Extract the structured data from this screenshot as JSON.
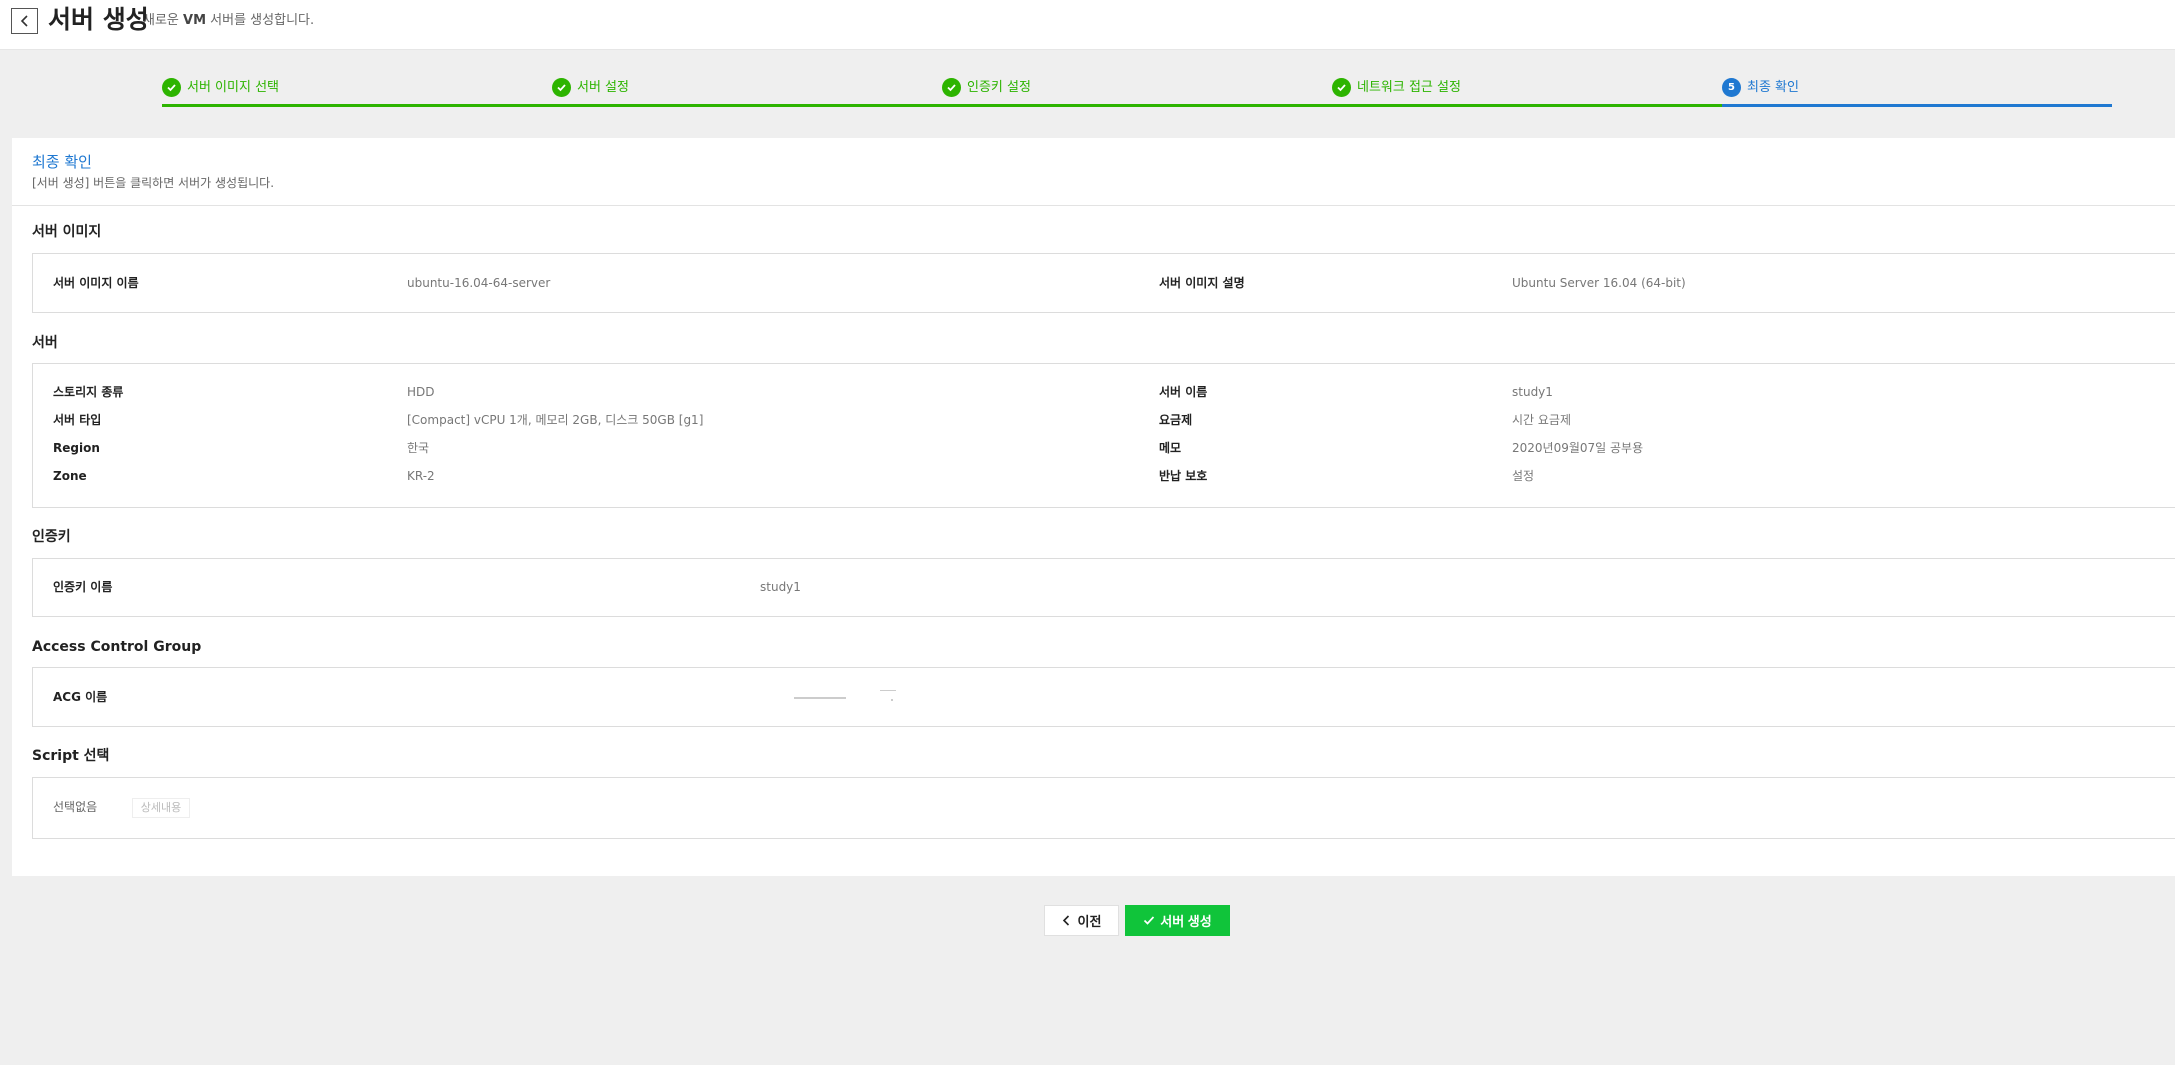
{
  "header": {
    "title": "서버 생성",
    "subtitle_prefix": "새로운",
    "subtitle_vm": "VM",
    "subtitle_suffix": "서버를 생성합니다."
  },
  "steps": [
    {
      "label": "서버 이미지 선택",
      "status": "done"
    },
    {
      "label": "서버 설정",
      "status": "done"
    },
    {
      "label": "인증키 설정",
      "status": "done"
    },
    {
      "label": "네트워크 접근 설정",
      "status": "done"
    },
    {
      "label": "최종 확인",
      "status": "current",
      "number": "5"
    }
  ],
  "panel": {
    "title": "최종 확인",
    "desc": "[서버 생성] 버튼을 클릭하면 서버가 생성됩니다."
  },
  "sections": {
    "image": {
      "title": "서버 이미지",
      "name_label": "서버 이미지 이름",
      "name_value": "ubuntu-16.04-64-server",
      "desc_label": "서버 이미지 설명",
      "desc_value": "Ubuntu Server 16.04 (64-bit)"
    },
    "server": {
      "title": "서버",
      "left": [
        {
          "label": "스토리지 종류",
          "value": "HDD"
        },
        {
          "label": "서버 타입",
          "value": "[Compact] vCPU 1개, 메모리 2GB, 디스크 50GB [g1]"
        },
        {
          "label": "Region",
          "value": "한국"
        },
        {
          "label": "Zone",
          "value": "KR-2"
        }
      ],
      "right": [
        {
          "label": "서버 이름",
          "value": "study1"
        },
        {
          "label": "요금제",
          "value": "시간 요금제"
        },
        {
          "label": "메모",
          "value": "2020년09월07일 공부용"
        },
        {
          "label": "반납 보호",
          "value": "설정"
        }
      ]
    },
    "authkey": {
      "title": "인증키",
      "label": "인증키 이름",
      "value": "study1"
    },
    "acg": {
      "title": "Access Control Group",
      "label": "ACG 이름"
    },
    "script": {
      "title": "Script 선택",
      "value": "선택없음",
      "detail_label": "상세내용"
    }
  },
  "buttons": {
    "prev": "이전",
    "create": "서버 생성"
  },
  "colors": {
    "done": "#2db400",
    "current": "#1f78d1",
    "create_button": "#10c43a"
  }
}
